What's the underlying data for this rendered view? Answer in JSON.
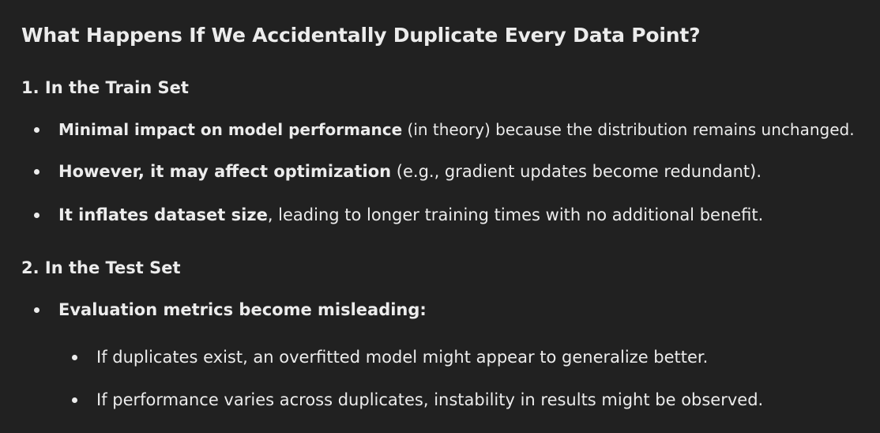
{
  "title": "What Happens If We Accidentally Duplicate Every Data Point?",
  "sections": [
    {
      "heading": "1. In the Train Set",
      "bullets": [
        {
          "bold": "Minimal impact on model performance",
          "rest": " (in theory) because the distribution remains unchanged."
        },
        {
          "bold": "However, it may affect optimization",
          "rest": " (e.g., gradient updates become redundant)."
        },
        {
          "bold": "It inflates dataset size",
          "rest": ", leading to longer training times with no additional benefit."
        }
      ]
    },
    {
      "heading": "2. In the Test Set",
      "bullets": [
        {
          "bold": "Evaluation metrics become misleading:",
          "rest": ""
        }
      ],
      "subbullets": [
        "If duplicates exist, an overfitted model might appear to generalize better.",
        "If performance varies across duplicates, instability in results might be observed."
      ]
    }
  ]
}
